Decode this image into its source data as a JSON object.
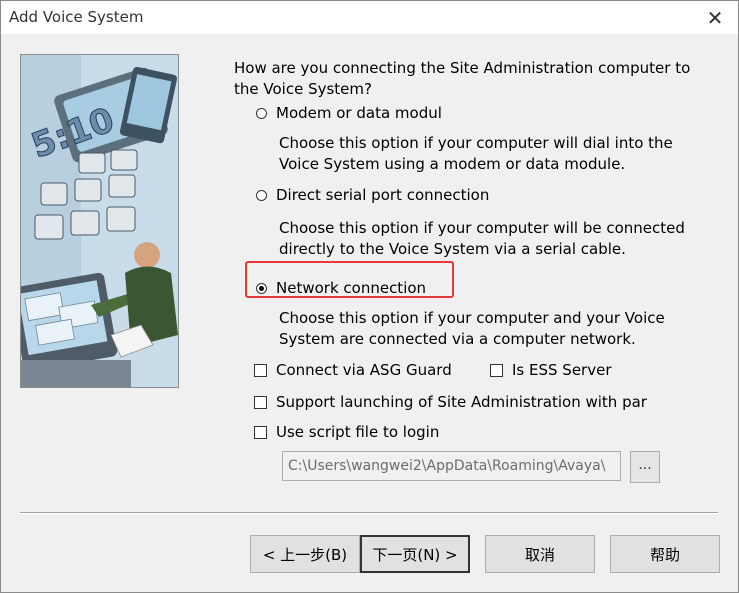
{
  "window": {
    "title": "Add Voice System",
    "close_glyph": "✕"
  },
  "question": "How are you connecting the Site Administration computer to the Voice System?",
  "options": [
    {
      "label": "Modem or data modul",
      "description": "Choose this option if your computer will dial into the Voice System using a modem or data module.",
      "selected": false
    },
    {
      "label": "Direct serial port connection",
      "description": "Choose this option if your computer will be connected directly to the Voice System via a serial cable.",
      "selected": false
    },
    {
      "label": "Network connection",
      "description": "Choose this option if your computer and your Voice System are connected via a computer network.",
      "selected": true
    }
  ],
  "checkboxes": {
    "asg_guard": "Connect via ASG Guard",
    "ess_server": "Is ESS Server",
    "support_launch": "Support launching of Site Administration with par",
    "script_file": "Use script file to login"
  },
  "script_path": {
    "value": "C:\\Users\\wangwei2\\AppData\\Roaming\\Avaya\\",
    "browse_label": "..."
  },
  "buttons": {
    "back": "< 上一步(B)",
    "next": "下一页(N) >",
    "cancel": "取消",
    "help": "帮助"
  },
  "colors": {
    "highlight": "#e53935",
    "background": "#f0f0f0",
    "illustration_sky": "#c7dbe9"
  },
  "icons": {
    "close": "close-icon",
    "illustration": "wizard-illustration"
  }
}
